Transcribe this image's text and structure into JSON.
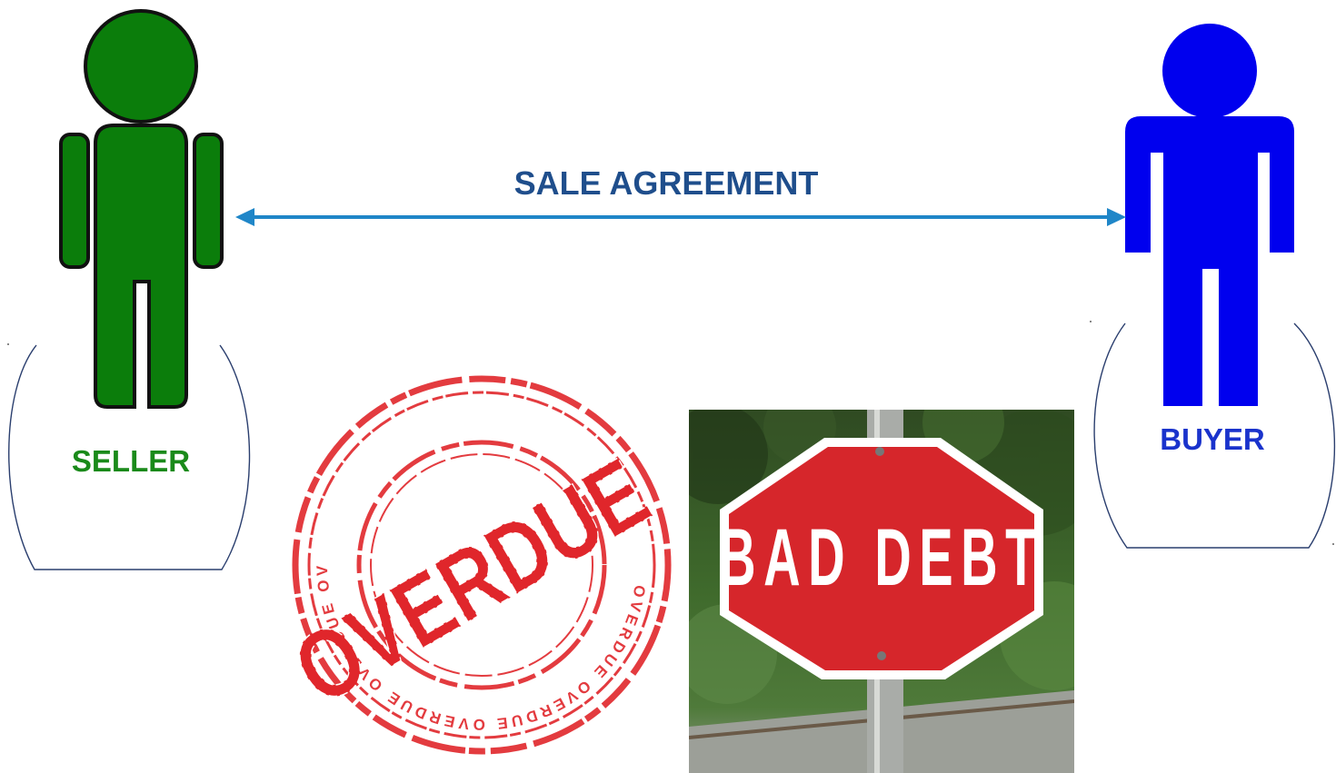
{
  "diagram": {
    "seller_label": "SELLER",
    "buyer_label": "BUYER",
    "agreement_label": "SALE AGREEMENT",
    "overdue_stamp": {
      "main_text": "OVERDUE",
      "ring_text": "OVERDUE OVERDUE OVERDUE OVERDUE OVERDUE"
    },
    "bad_debt_sign": {
      "text": "BAD DEBT"
    }
  },
  "colors": {
    "seller": "#0b7d0b",
    "seller_label": "#1a8a1a",
    "buyer": "#0000ee",
    "buyer_label": "#1a33cc",
    "agreement_label": "#1f4e8c",
    "arrow": "#1f86c8",
    "stamp_red": "#e0262b",
    "sign_red": "#d6262b"
  }
}
